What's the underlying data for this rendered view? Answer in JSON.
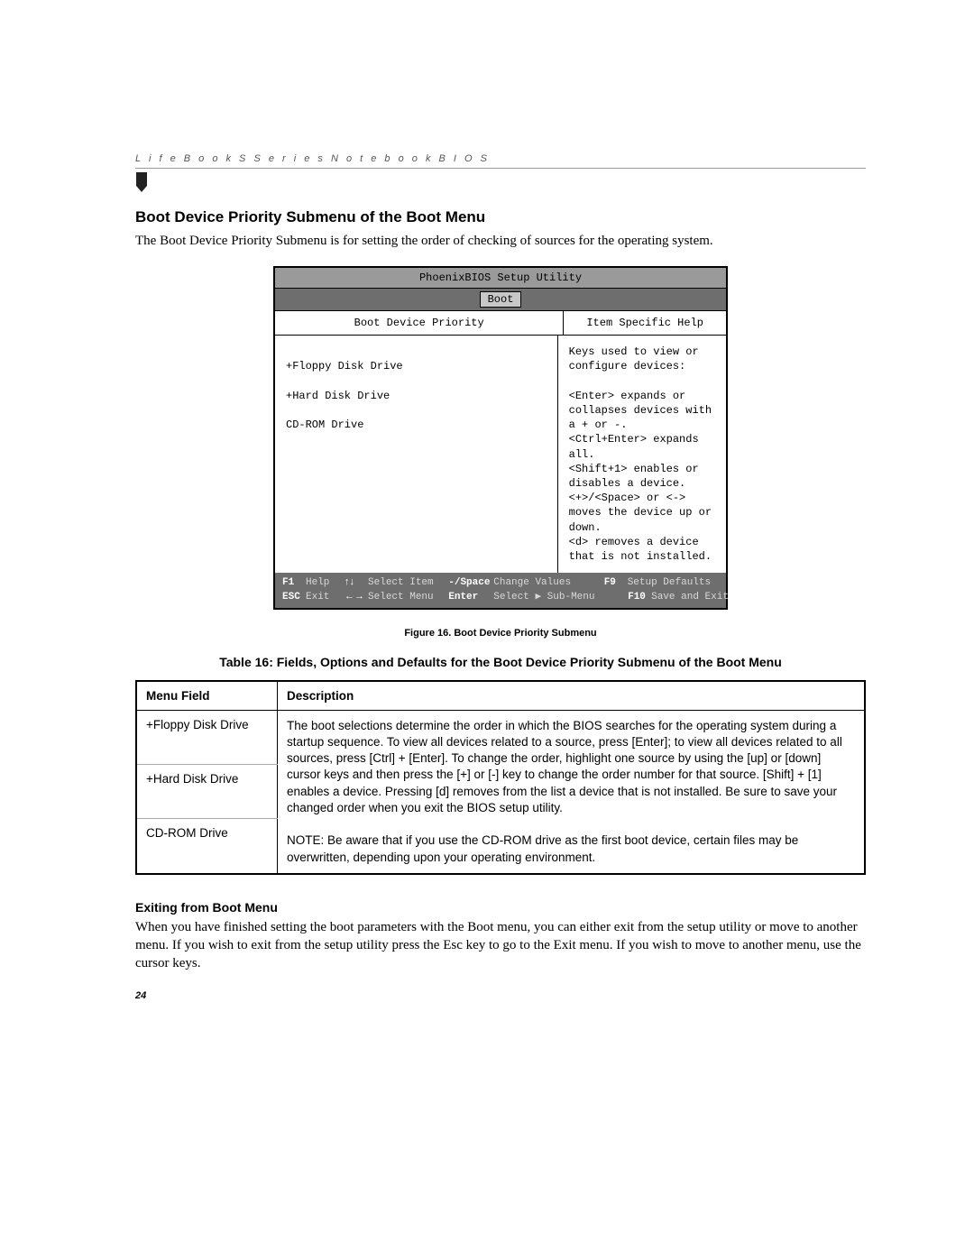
{
  "running_head": "L i f e B o o k   S   S e r i e s   N o t e b o o k   B I O S",
  "section_title": "Boot Device Priority Submenu of the Boot Menu",
  "intro": "The Boot Device Priority Submenu is for setting the order of checking of sources for the operating system.",
  "bios": {
    "title": "PhoenixBIOS Setup Utility",
    "active_tab": "Boot",
    "left_head": "Boot Device Priority",
    "right_head": "Item Specific Help",
    "devices": [
      "+Floppy Disk Drive",
      "+Hard Disk Drive",
      " CD-ROM Drive"
    ],
    "help_text": "Keys used to view or\nconfigure devices:\n\n<Enter> expands or\ncollapses devices with\na + or -.\n<Ctrl+Enter> expands\nall.\n<Shift+1> enables or\ndisables a device.\n<+>/<Space> or <->\nmoves the device up or\ndown.\n<d> removes a device\nthat is not installed.",
    "footer": {
      "f1": "F1",
      "help": "Help",
      "updown": "↑↓",
      "select_item": "Select Item",
      "minus_space": "-/Space",
      "change_values": "Change Values",
      "f9": "F9",
      "setup_defaults": "Setup Defaults",
      "esc": "ESC",
      "exit": "Exit",
      "leftright": "←→",
      "select_menu": "Select Menu",
      "enter": "Enter",
      "select_sub": "Select ▶ Sub-Menu",
      "f10": "F10",
      "save_exit": "Save and Exit"
    }
  },
  "figure_caption": "Figure 16.  Boot Device Priority Submenu",
  "table_title": "Table 16: Fields, Options and Defaults for the Boot Device Priority Submenu of the Boot Menu",
  "table": {
    "head1": "Menu Field",
    "head2": "Description",
    "fields": [
      "+Floppy Disk Drive",
      "+Hard Disk Drive",
      "CD-ROM Drive"
    ],
    "description": "The boot selections determine the order in which the BIOS searches for the operating system during a startup sequence. To view all devices related to a source, press [Enter]; to view all devices related to all sources, press [Ctrl] + [Enter]. To change the order, highlight one source by using the [up] or [down] cursor keys and then press the [+] or [-] key to change the order number for that source. [Shift] + [1] enables a device. Pressing [d] removes from the list a device that is not installed. Be sure to save your changed order when you exit the BIOS setup utility.",
    "note": "NOTE: Be aware that if you use the CD-ROM drive as the first boot device, certain files may be overwritten, depending upon your operating environment."
  },
  "exit_head": "Exiting from Boot Menu",
  "exit_body": "When you have finished setting the boot parameters with the Boot menu, you can either exit from the setup utility or move to another menu. If you wish to exit from the setup utility press the Esc key to go to the Exit menu. If you wish to move to another menu, use the cursor keys.",
  "page_number": "24"
}
